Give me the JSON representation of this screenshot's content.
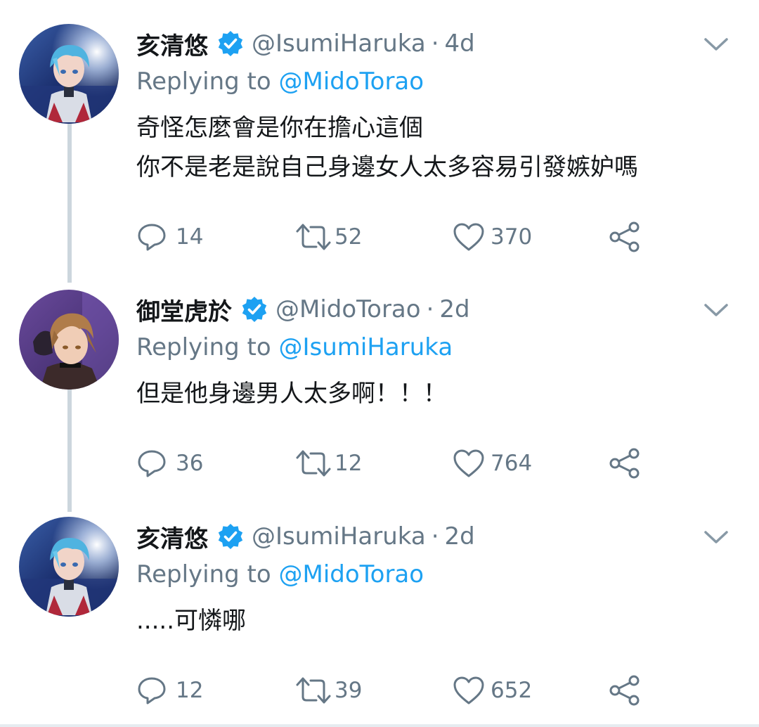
{
  "tweets": [
    {
      "display_name": "亥清悠",
      "handle": "@IsumiHaruka",
      "separator": "·",
      "time": "4d",
      "replying_prefix": "Replying to",
      "replying_to": "@MidoTorao",
      "text_lines": [
        "奇怪怎麼會是你在擔心這個",
        "你不是老是說自己身邊女人太多容易引發嫉妒嗎"
      ],
      "replies": "14",
      "retweets": "52",
      "likes": "370",
      "avatar": "blue-haired-character-avatar"
    },
    {
      "display_name": "御堂虎於",
      "handle": "@MidoTorao",
      "separator": "·",
      "time": "2d",
      "replying_prefix": "Replying to",
      "replying_to": "@IsumiHaruka",
      "text_lines": [
        "但是他身邊男人太多啊！！！"
      ],
      "replies": "36",
      "retweets": "12",
      "likes": "764",
      "avatar": "brown-haired-character-avatar"
    },
    {
      "display_name": "亥清悠",
      "handle": "@IsumiHaruka",
      "separator": "·",
      "time": "2d",
      "replying_prefix": "Replying to",
      "replying_to": "@MidoTorao",
      "text_lines": [
        ".....可憐哪"
      ],
      "replies": "12",
      "retweets": "39",
      "likes": "652",
      "avatar": "blue-haired-character-avatar"
    }
  ],
  "colors": {
    "accent": "#1da1f2",
    "secondary_text": "#657786",
    "primary_text": "#14171a",
    "thread_line": "#ccd6dd"
  },
  "icons": [
    "verified-badge-icon",
    "chevron-down-icon",
    "reply-icon",
    "retweet-icon",
    "like-icon",
    "share-icon"
  ]
}
